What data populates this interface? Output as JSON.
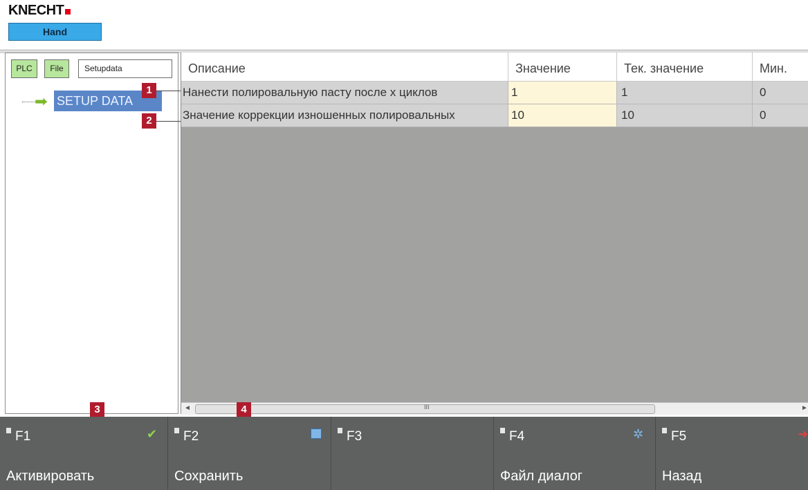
{
  "header": {
    "brand": "KNECHT",
    "mode": "Hand"
  },
  "left_panel": {
    "buttons": {
      "plc": "PLC",
      "file": "File",
      "setup": "Setupdata"
    },
    "tree": {
      "node": "SETUP DATA"
    }
  },
  "table": {
    "columns": [
      "Описание",
      "Значение",
      "Тек. значение",
      "Мин."
    ],
    "rows": [
      {
        "description": "Нанести полировальную пасту после х циклов",
        "value": "1",
        "current": "1",
        "min": "0"
      },
      {
        "description": "Значение коррекции изношенных полировальных",
        "value": "10",
        "current": "10",
        "min": "0"
      }
    ]
  },
  "scrollbar": {
    "grip": "III"
  },
  "callouts": [
    "1",
    "2",
    "3",
    "4"
  ],
  "function_keys": [
    {
      "key": "F1",
      "label": "Активировать",
      "icon": "checkmark-icon"
    },
    {
      "key": "F2",
      "label": "Сохранить",
      "icon": "save-icon"
    },
    {
      "key": "F3",
      "label": "",
      "icon": ""
    },
    {
      "key": "F4",
      "label": "Файл диалог",
      "icon": "gear-icon"
    },
    {
      "key": "F5",
      "label": "Назад",
      "icon": "exit-icon"
    }
  ],
  "colors": {
    "brand_red": "#e3001b",
    "mode_blue": "#39a9e7",
    "toggle_green": "#b7e69d",
    "selection_blue": "#5a86c8",
    "value_highlight": "#fdf6d8",
    "callout_red": "#b01c2e",
    "fbar_gray": "#5f6060",
    "table_bg_gray": "#a2a2a1"
  }
}
